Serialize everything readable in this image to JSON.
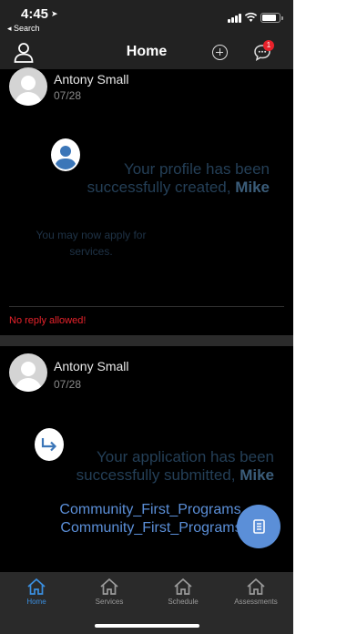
{
  "status_bar": {
    "time": "4:45",
    "back_label": "◂ Search"
  },
  "header": {
    "title": "Home",
    "notification_count": "1"
  },
  "messages": [
    {
      "sender": "Antony Small",
      "date": "07/28",
      "icon": "profile-person-icon",
      "main_text": "Your profile has been successfully created,",
      "main_name": "Mike",
      "sub_text": "You may now apply for services.",
      "footer": "No reply allowed!"
    },
    {
      "sender": "Antony Small",
      "date": "07/28",
      "icon": "submit-arrow-icon",
      "main_text": "Your application has been successfully submitted,",
      "main_name": "Mike",
      "programs": [
        "Community_First_Programs",
        "Community_First_Programs"
      ]
    }
  ],
  "fab": {
    "icon": "document-icon"
  },
  "tabs": [
    {
      "label": "Home",
      "active": true
    },
    {
      "label": "Services",
      "active": false
    },
    {
      "label": "Schedule",
      "active": false
    },
    {
      "label": "Assessments",
      "active": false
    }
  ],
  "colors": {
    "accent": "#3b8fe0",
    "fab": "#5b8fd8",
    "error": "#e8222b",
    "bar": "#2a2a2a"
  }
}
